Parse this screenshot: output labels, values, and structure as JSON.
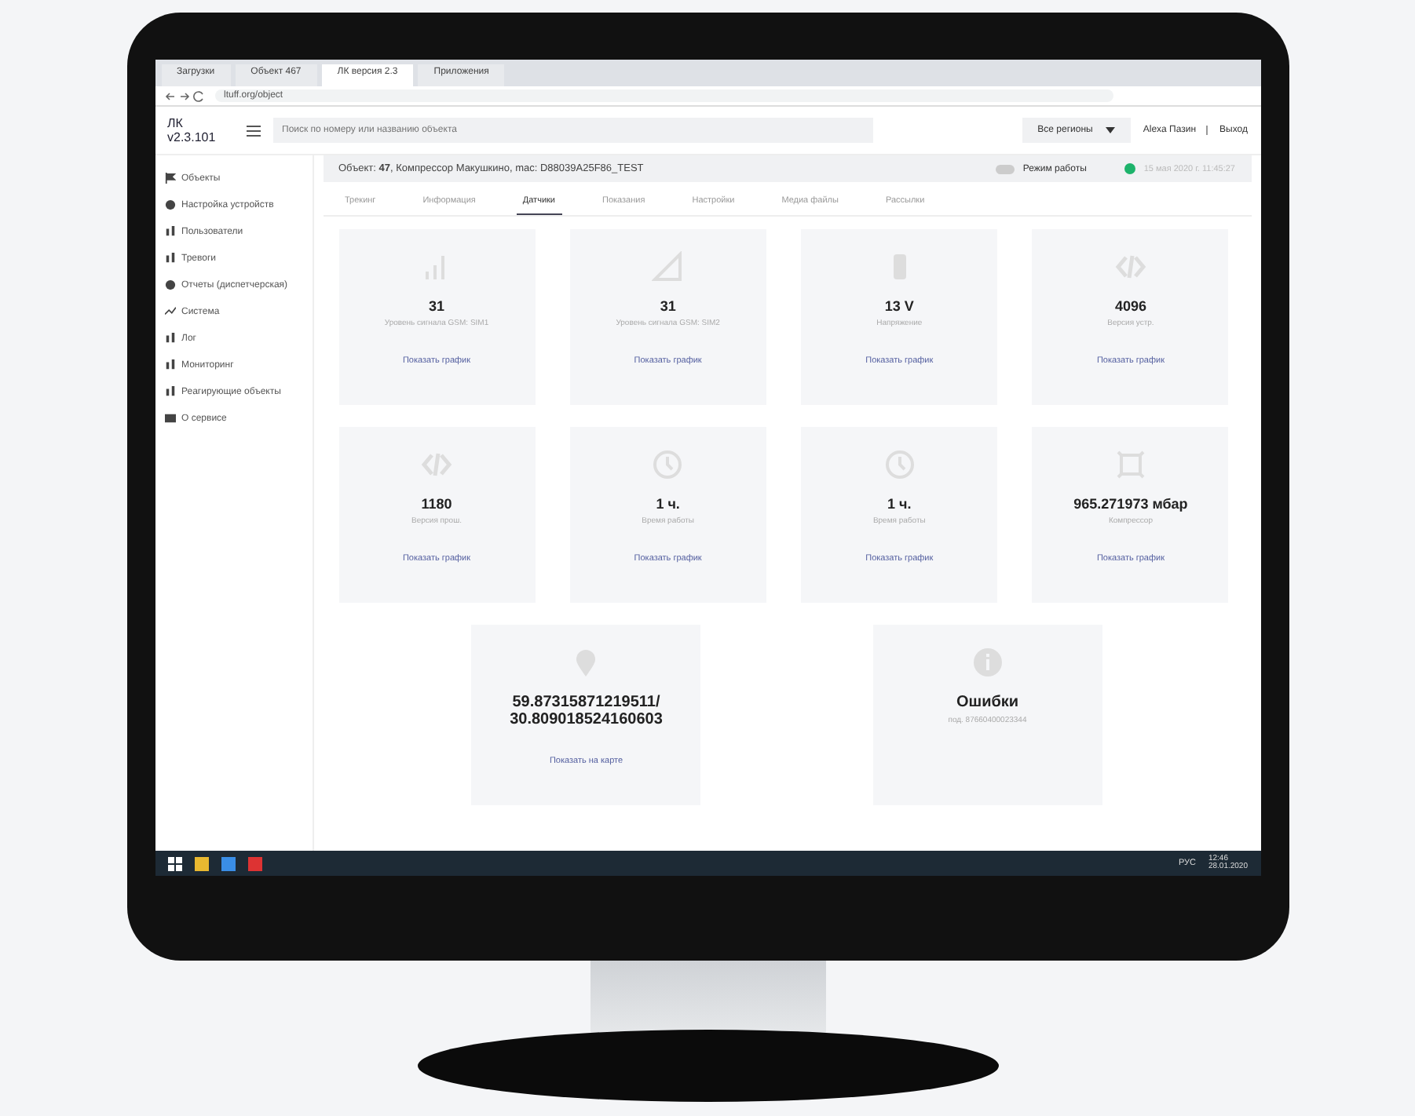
{
  "browser": {
    "tabs": [
      {
        "label": "Загрузки",
        "selected": false
      },
      {
        "label": "Объект 467",
        "selected": false
      },
      {
        "label": "ЛК версия 2.3",
        "selected": true
      },
      {
        "label": "Приложения",
        "selected": false
      }
    ],
    "address": "ltuff.org/object"
  },
  "header": {
    "logo": "ЛК v2.3.101",
    "search": {
      "placeholder": "Поиск по номеру или названию объекта"
    },
    "region": "Все регионы",
    "user": "Alexa Пазин",
    "logout": "Выход"
  },
  "sidebar": {
    "items": [
      {
        "label": "Объекты"
      },
      {
        "label": "Настройка устройств"
      },
      {
        "label": "Пользователи"
      },
      {
        "label": "Тревоги"
      },
      {
        "label": "Отчеты (диспетчерская)"
      },
      {
        "label": "Система"
      },
      {
        "label": "Лог"
      },
      {
        "label": "Мониторинг"
      },
      {
        "label": "Реагирующие объекты"
      },
      {
        "label": "О сервисе"
      }
    ]
  },
  "object_bar": {
    "text": "Объект: **47**, Компрессор Макушкино, mac: D88039A25F86_TEST",
    "mode_label": "Режим работы",
    "mode_on": false,
    "date": "15 мая 2020 г. 11:45:27"
  },
  "tabs": [
    {
      "label": "Трекинг",
      "selected": false
    },
    {
      "label": "Информация",
      "selected": false
    },
    {
      "label": "Датчики",
      "selected": true
    },
    {
      "label": "Показания",
      "selected": false
    },
    {
      "label": "Настройки",
      "selected": false
    },
    {
      "label": "Медиа файлы",
      "selected": false
    },
    {
      "label": "Рассылки",
      "selected": false
    }
  ],
  "sensors": [
    {
      "kind": "signal",
      "value": "31",
      "label": "Уровень сигнала GSM: SIM1",
      "link": "Показать график"
    },
    {
      "kind": "triangle",
      "value": "31",
      "label": "Уровень сигнала GSM: SIM2",
      "link": "Показать график"
    },
    {
      "kind": "battery",
      "value": "13 V",
      "label": "Напряжение",
      "link": "Показать график"
    },
    {
      "kind": "code",
      "value": "4096",
      "label": "Версия устр.",
      "link": "Показать график"
    },
    {
      "kind": "code",
      "value": "1180",
      "label": "Версия прош.",
      "link": "Показать график"
    },
    {
      "kind": "clock",
      "value": "1 ч.",
      "label": "Время работы",
      "link": "Показать график"
    },
    {
      "kind": "clock",
      "value": "1 ч.",
      "label": "Время работы",
      "link": "Показать график"
    },
    {
      "kind": "gauge",
      "value": "965.271973 мбар",
      "label": "Компрессор",
      "link": "Показать график"
    }
  ],
  "extra": [
    {
      "kind": "location",
      "value": "59.87315871219511/ 30.809018524160603",
      "link": "Показать на карте"
    },
    {
      "kind": "errors",
      "value": "Ошибки",
      "label": "под. 87660400023344"
    }
  ],
  "taskbar": {
    "lang": "РУС",
    "time": "12:46",
    "date": "28.01.2020"
  }
}
